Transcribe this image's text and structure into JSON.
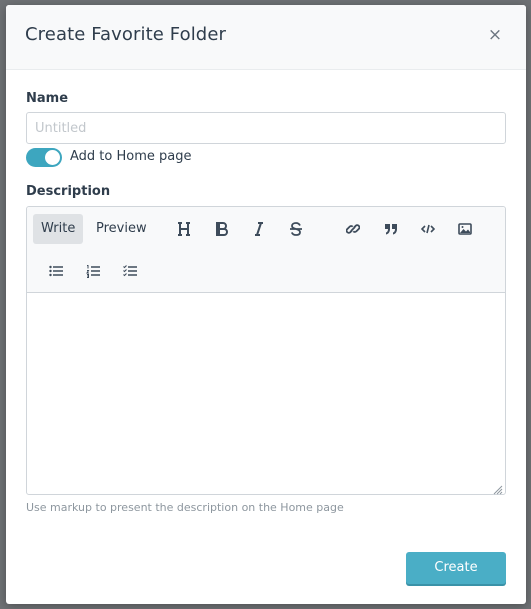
{
  "modal": {
    "title": "Create Favorite Folder",
    "close_label": "×"
  },
  "name": {
    "label": "Name",
    "value": "",
    "placeholder": "Untitled"
  },
  "home_toggle": {
    "label": "Add to Home page",
    "checked": true
  },
  "description": {
    "label": "Description",
    "tabs": [
      {
        "label": "Write",
        "active": true
      },
      {
        "label": "Preview",
        "active": false
      }
    ],
    "tools": [
      {
        "icon": "heading-icon"
      },
      {
        "icon": "bold-icon"
      },
      {
        "icon": "italic-icon"
      },
      {
        "icon": "strikethrough-icon"
      },
      {
        "icon": "link-icon"
      },
      {
        "icon": "quote-icon"
      },
      {
        "icon": "code-icon"
      },
      {
        "icon": "image-icon"
      },
      {
        "icon": "bulleted-list-icon"
      },
      {
        "icon": "numbered-list-icon"
      },
      {
        "icon": "task-list-icon"
      }
    ],
    "value": "",
    "help_text": "Use markup to present the description on the Home page"
  },
  "footer": {
    "create_label": "Create"
  },
  "colors": {
    "accent": "#4aaec6",
    "toggle_on": "#3da6bf",
    "title_text": "#2f3d4c"
  }
}
